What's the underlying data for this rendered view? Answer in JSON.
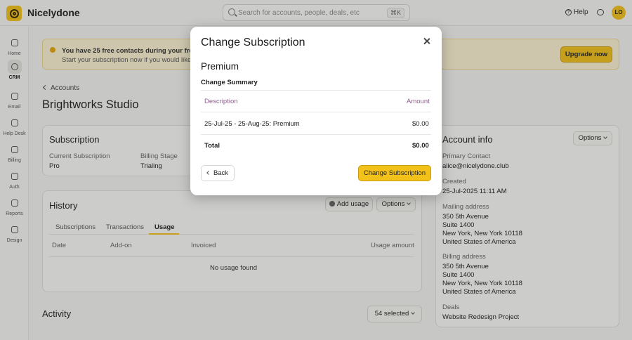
{
  "brand": {
    "name": "Nicelydone"
  },
  "search": {
    "placeholder": "Search for accounts, people, deals, etc",
    "shortcut": "⌘K"
  },
  "header": {
    "help_label": "Help",
    "avatar_initials": "LO"
  },
  "sidebar": {
    "items": [
      {
        "label": "Home",
        "icon": "home-icon",
        "active": false
      },
      {
        "label": "CRM",
        "icon": "crm-icon",
        "active": true
      },
      {
        "label": "Email",
        "icon": "email-icon",
        "active": false
      },
      {
        "label": "Help Desk",
        "icon": "help-desk-icon",
        "active": false
      },
      {
        "label": "Billing",
        "icon": "billing-icon",
        "active": false
      },
      {
        "label": "Auth",
        "icon": "auth-icon",
        "active": false
      },
      {
        "label": "Reports",
        "icon": "reports-icon",
        "active": false
      },
      {
        "label": "Design",
        "icon": "design-icon",
        "active": false
      }
    ]
  },
  "banner": {
    "title": "You have 25 free contacts during your free trial",
    "text": "Start your subscription now if you would like to k",
    "upgrade_label": "Upgrade now"
  },
  "breadcrumb": {
    "label": "Accounts"
  },
  "page": {
    "title": "Brightworks Studio"
  },
  "subscription": {
    "title": "Subscription",
    "current_label": "Current Subscription",
    "current_value": "Pro",
    "stage_label": "Billing Stage",
    "stage_value": "Trialing"
  },
  "history": {
    "title": "History",
    "add_usage_label": "Add usage",
    "options_label": "Options",
    "tabs": [
      "Subscriptions",
      "Transactions",
      "Usage"
    ],
    "active_tab": "Usage",
    "columns": [
      "Date",
      "Add-on",
      "Invoiced",
      "Usage amount"
    ],
    "empty_text": "No usage found"
  },
  "account_info": {
    "title": "Account info",
    "options_label": "Options",
    "primary_contact_label": "Primary Contact",
    "primary_contact_value": "alice@nicelydone.club",
    "created_label": "Created",
    "created_value": "25-Jul-2025 11:11 AM",
    "mailing_label": "Mailing address",
    "mailing_lines": [
      "350 5th Avenue",
      "Suite 1400",
      "New York, New York  10118",
      "United States of America"
    ],
    "billing_label": "Billing address",
    "billing_lines": [
      "350 5th Avenue",
      "Suite 1400",
      "New York, New York  10118",
      "United States of America"
    ],
    "deals_label": "Deals",
    "deals_value": "Website Redesign Project"
  },
  "activity": {
    "title": "Activity",
    "selected_label": "54 selected"
  },
  "modal": {
    "title": "Change Subscription",
    "plan": "Premium",
    "summary_label": "Change Summary",
    "columns": {
      "description": "Description",
      "amount": "Amount"
    },
    "rows": [
      {
        "description": "25-Jul-25 - 25-Aug-25: Premium",
        "amount": "$0.00"
      }
    ],
    "total_label": "Total",
    "total_amount": "$0.00",
    "back_label": "Back",
    "confirm_label": "Change Subscription"
  },
  "colors": {
    "accent": "#f2c21a",
    "banner_bg": "#fbf3d3",
    "header_text": "#8a5f8a"
  }
}
